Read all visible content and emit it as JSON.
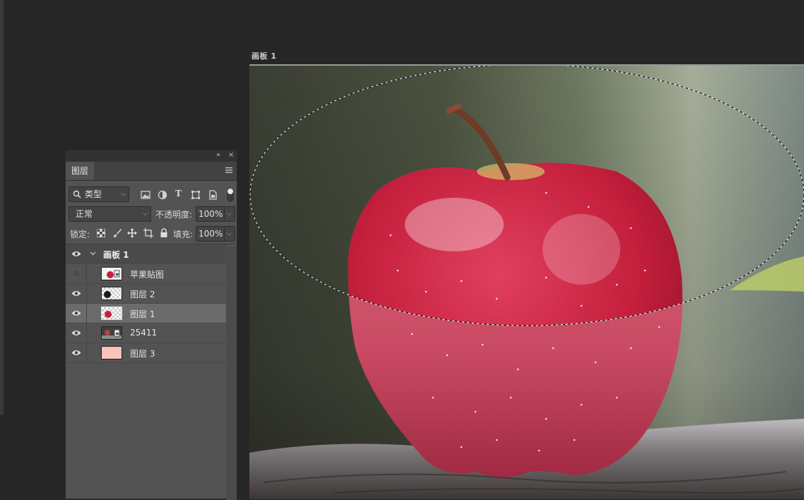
{
  "artboard": {
    "label": "画板 1"
  },
  "panel": {
    "tab_label": "图层",
    "filter": {
      "value": "类型"
    },
    "blend_mode": {
      "value": "正常"
    },
    "opacity": {
      "label": "不透明度:",
      "value": "100%"
    },
    "lock": {
      "label": "锁定:"
    },
    "fill": {
      "label": "填充:",
      "value": "100%"
    },
    "group": {
      "name": "画板 1"
    },
    "layers": [
      {
        "name": "苹果贴图",
        "visible": false,
        "selected": false
      },
      {
        "name": "图层 2",
        "visible": true,
        "selected": false
      },
      {
        "name": "图层 1",
        "visible": true,
        "selected": true
      },
      {
        "name": "25411",
        "visible": true,
        "selected": false
      },
      {
        "name": "图层 3",
        "visible": true,
        "selected": false
      }
    ]
  },
  "colors": {
    "app_bg": "#262626",
    "panel_bg": "#535353",
    "selected_row": "#6b6b6b",
    "layer3_fill": "#f8c3bc",
    "apple_red": "#c8203b"
  }
}
